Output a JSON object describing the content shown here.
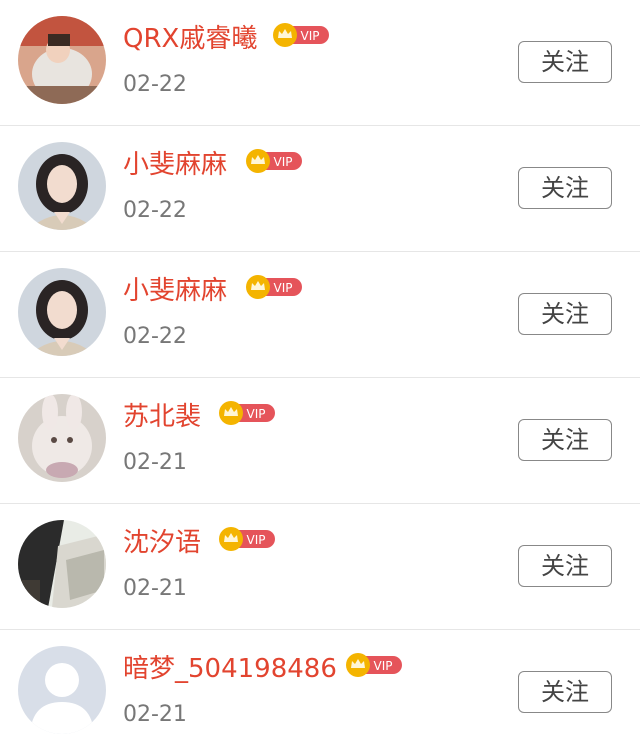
{
  "follow_list": [
    {
      "name": "QRX戚睿曦",
      "date": "02-22",
      "badge": "VIP",
      "action": "关注",
      "avatar": "photo-avatar"
    },
    {
      "name": "小斐麻麻",
      "date": "02-22",
      "badge": "VIP",
      "action": "关注",
      "avatar": "photo-avatar"
    },
    {
      "name": "小斐麻麻",
      "date": "02-22",
      "badge": "VIP",
      "action": "关注",
      "avatar": "photo-avatar"
    },
    {
      "name": "苏北裴",
      "date": "02-21",
      "badge": "VIP",
      "action": "关注",
      "avatar": "photo-avatar"
    },
    {
      "name": "沈汐语",
      "date": "02-21",
      "badge": "VIP",
      "action": "关注",
      "avatar": "photo-avatar"
    },
    {
      "name": "暗梦_504198486",
      "date": "02-21",
      "badge": "VIP",
      "action": "关注",
      "avatar": "default-user-avatar"
    }
  ],
  "colors": {
    "name": "#e2442f",
    "vip_badge": "#e5545a",
    "crown": "#f4b400",
    "date": "#777777",
    "button_border": "#888888",
    "divider": "#e6e6e6"
  }
}
